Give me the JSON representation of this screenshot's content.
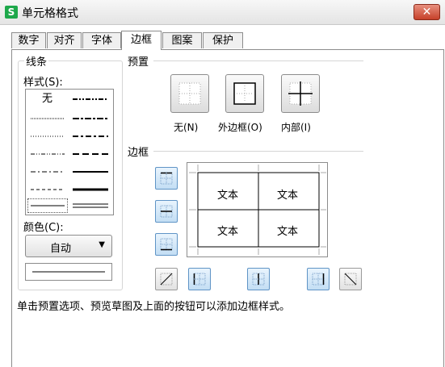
{
  "window": {
    "title": "单元格格式",
    "app_icon": "S",
    "close_glyph": "✕"
  },
  "tabs": [
    {
      "label": "数字",
      "active": false
    },
    {
      "label": "对齐",
      "active": false
    },
    {
      "label": "字体",
      "active": false
    },
    {
      "label": "边框",
      "active": true
    },
    {
      "label": "图案",
      "active": false
    },
    {
      "label": "保护",
      "active": false
    }
  ],
  "line_group": {
    "title": "线条",
    "style_label": "样式(S):",
    "none_label": "无",
    "color_label": "颜色(C):",
    "color_value": "自动",
    "dropdown_icon": "triangle-down-icon"
  },
  "presets": {
    "title": "预置",
    "none": "无(N)",
    "outline": "外边框(O)",
    "inside": "内部(I)"
  },
  "border": {
    "title": "边框",
    "cell_texts": [
      "文本",
      "文本",
      "文本",
      "文本"
    ]
  },
  "hint": "单击预置选项、预览草图及上面的按钮可以添加边框样式。",
  "colors": {
    "accent_border": "#5f94c6",
    "app_green": "#1ea84b",
    "close_red": "#c6412a"
  }
}
